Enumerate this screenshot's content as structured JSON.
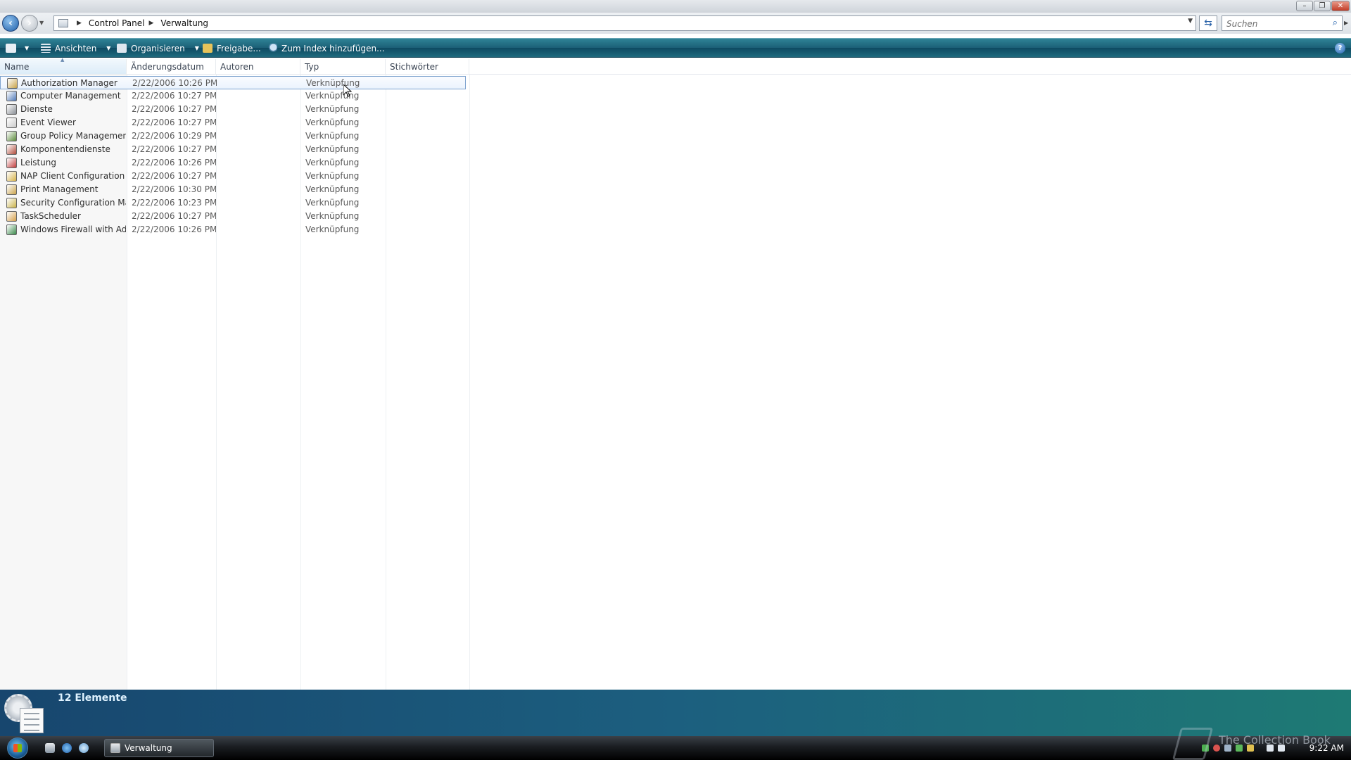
{
  "window": {
    "address": {
      "crumbs": [
        "Control Panel",
        "Verwaltung"
      ]
    },
    "search": {
      "placeholder": "Suchen"
    }
  },
  "toolbar": {
    "views_label": "Ansichten",
    "organize_label": "Organisieren",
    "share_label": "Freigabe...",
    "index_label": "Zum Index hinzufügen..."
  },
  "columns": {
    "name": "Name",
    "modified": "Änderungsdatum",
    "authors": "Autoren",
    "type": "Typ",
    "keywords": "Stichwörter"
  },
  "files": [
    {
      "name": "Authorization Manager",
      "date": "2/22/2006 10:26 PM",
      "type": "Verknüpfung",
      "icon_color": "#c8a34a"
    },
    {
      "name": "Computer Management",
      "date": "2/22/2006 10:27 PM",
      "type": "Verknüpfung",
      "icon_color": "#4f78b8"
    },
    {
      "name": "Dienste",
      "date": "2/22/2006 10:27 PM",
      "type": "Verknüpfung",
      "icon_color": "#8a8f96"
    },
    {
      "name": "Event Viewer",
      "date": "2/22/2006 10:27 PM",
      "type": "Verknüpfung",
      "icon_color": "#c9c9c9"
    },
    {
      "name": "Group Policy Management",
      "date": "2/22/2006 10:29 PM",
      "type": "Verknüpfung",
      "icon_color": "#5b8b3a"
    },
    {
      "name": "Komponentendienste",
      "date": "2/22/2006 10:27 PM",
      "type": "Verknüpfung",
      "icon_color": "#b04a3a"
    },
    {
      "name": "Leistung",
      "date": "2/22/2006 10:26 PM",
      "type": "Verknüpfung",
      "icon_color": "#c23c3c"
    },
    {
      "name": "NAP Client Configuration",
      "date": "2/22/2006 10:27 PM",
      "type": "Verknüpfung",
      "icon_color": "#d6b24a"
    },
    {
      "name": "Print Management",
      "date": "2/22/2006 10:30 PM",
      "type": "Verknüpfung",
      "icon_color": "#c9a24a"
    },
    {
      "name": "Security Configuration Ma...",
      "date": "2/22/2006 10:23 PM",
      "type": "Verknüpfung",
      "icon_color": "#c9b24a"
    },
    {
      "name": "TaskScheduler",
      "date": "2/22/2006 10:27 PM",
      "type": "Verknüpfung",
      "icon_color": "#d6a04a"
    },
    {
      "name": "Windows Firewall with Ad...",
      "date": "2/22/2006 10:26 PM",
      "type": "Verknüpfung",
      "icon_color": "#3a8a4a"
    }
  ],
  "selected_index": 0,
  "details": {
    "count_label": "12 Elemente"
  },
  "taskbar": {
    "window_button_label": "Verwaltung",
    "clock": "9:22 AM",
    "watermark": "The Collection Book"
  },
  "colors": {
    "command_bar": "#1b5f76",
    "details_pane": "#1c5f7f",
    "selection_border": "#7da2ce"
  }
}
